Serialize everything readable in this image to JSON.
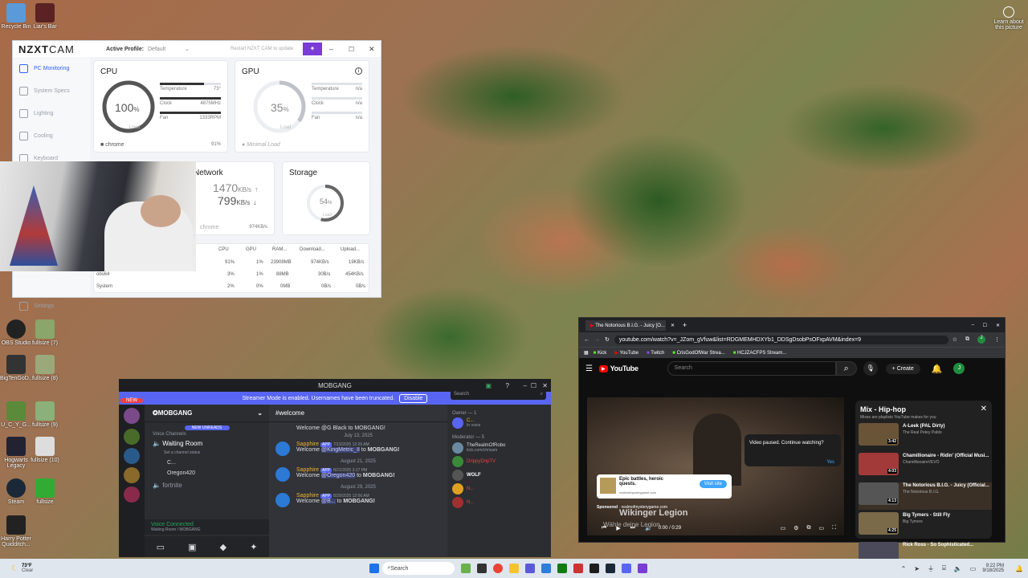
{
  "desktop": {
    "icons": [
      {
        "label": "Recycle Bin",
        "color": "#4a90c8"
      },
      {
        "label": "Liar's Bar",
        "color": "#3a2a2a"
      },
      {
        "label": "OBS Studio",
        "color": "#222"
      },
      {
        "label": "fullsize (7)",
        "color": "#8a7"
      },
      {
        "label": "BigTenGoD...",
        "color": "#333"
      },
      {
        "label": "fullsize (8)",
        "color": "#9a8"
      },
      {
        "label": "U_C_Y_G...",
        "color": "#6a4"
      },
      {
        "label": "fullsize (9)",
        "color": "#8b7"
      },
      {
        "label": "Hogwarts Legacy",
        "color": "#233"
      },
      {
        "label": "fullsize (10)",
        "color": "#ddd"
      },
      {
        "label": "Steam",
        "color": "#1b2838"
      },
      {
        "label": "fullsize",
        "color": "#3c3"
      },
      {
        "label": "Harry Potter Quidditch...",
        "color": "#222"
      }
    ],
    "learn": "Learn about this picture"
  },
  "nzxt": {
    "logo_bold": "NZXT",
    "logo_light": "CAM",
    "profile_label": "Active Profile:",
    "profile_value": "Default",
    "restart": "Restart NZXT CAM to update",
    "nav": [
      "PC Monitoring",
      "System Specs",
      "Lighting",
      "Cooling",
      "Keyboard"
    ],
    "settings": "Settings",
    "cpu": {
      "title": "CPU",
      "load": "100",
      "load_frac": 1.0,
      "load_label": "Load",
      "temp_label": "Temperature",
      "temp": "73°",
      "clock_label": "Clock",
      "clock": "4875MHz",
      "fan_label": "Fan",
      "fan": "1333RPM",
      "proc": "chrome",
      "proc_val": "91%"
    },
    "gpu": {
      "title": "GPU",
      "load": "35",
      "load_frac": 0.35,
      "load_label": "Load",
      "temp_label": "Temperature",
      "temp": "n/a",
      "clock_label": "Clock",
      "clock": "n/a",
      "fan_label": "Fan",
      "fan": "n/a",
      "proc": "Minimal Load"
    },
    "network": {
      "title": "Network",
      "down": "1470",
      "up": "799",
      "unit": "KB/s",
      "proc": "chrome",
      "proc_val": "974KB/s"
    },
    "storage": {
      "title": "Storage",
      "load": "54",
      "load_frac": 0.54,
      "load_label": "Load"
    },
    "table": {
      "headers": [
        "CPU",
        "GPU",
        "RAM...",
        "Download...",
        "Upload..."
      ],
      "rows": [
        {
          "name": "",
          "cpu": "91%",
          "gpu": "1%",
          "ram": "23908MB",
          "down": "974KB/s",
          "up": "19KB/s"
        },
        {
          "name": "obs64",
          "cpu": "3%",
          "gpu": "1%",
          "ram": "88MB",
          "down": "30B/s",
          "up": "454KB/s"
        },
        {
          "name": "System",
          "cpu": "2%",
          "gpu": "0%",
          "ram": "0MB",
          "down": "0B/s",
          "up": "0B/s"
        }
      ]
    }
  },
  "discord": {
    "title": "MOBGANG",
    "banner": "Streamer Mode is enabled. Usernames have been truncated.",
    "disable": "Disable",
    "server": "MOBGANG",
    "new_unreads": "NEW UNREADS",
    "voice_channels": "Voice Channels",
    "waiting_room": "Waiting Room",
    "channel_status": "Set a channel status",
    "voice_users": [
      "C...",
      "Oregon420"
    ],
    "fortnite": "fortnite",
    "voice_connected": "Voice Connected",
    "voice_path": "Waiting Room / MOBGANG",
    "channel": "welcome",
    "search": "Search",
    "messages": [
      {
        "top": "Welcome @G Black to MOBGANG!",
        "date": "July 13, 2025"
      },
      {
        "name": "Sapphire",
        "tag": "APP",
        "time": "7/13/2025 12:26 AM",
        "text_a": "Welcome ",
        "mention": "@KingMetric_II",
        "text_b": " to ",
        "bold": "MOBGANG!",
        "date_after": "August 21, 2025"
      },
      {
        "name": "Sapphire",
        "tag": "APP",
        "time": "8/21/2025 3:17 PM",
        "text_a": "Welcome ",
        "mention": "@Oregon420",
        "text_b": " to ",
        "bold": "MOBGANG!",
        "date_after": "August 29, 2025"
      },
      {
        "name": "Sapphire",
        "tag": "APP",
        "time": "8/29/2025 12:06 AM",
        "text_a": "Welcome ",
        "mention": "@B...",
        "text_b": " to ",
        "bold": "MOBGANG!"
      }
    ],
    "owner": "Owner — 1",
    "owner_user": "C...",
    "owner_status": "In voice",
    "moderator": "Moderator — 5",
    "mods": [
      {
        "name": "TheRealmOfRobo",
        "sub": "kick.com/chrisam",
        "color": "#dbdee1"
      },
      {
        "name": "DrippyDripTV",
        "sub": "",
        "color": "#f23f43"
      },
      {
        "name": "WOLF",
        "sub": "",
        "color": "#fff"
      },
      {
        "name": "N...",
        "sub": "",
        "color": "#f23f43"
      },
      {
        "name": "N...",
        "sub": "",
        "color": "#f23f43"
      }
    ],
    "badge_new": "NEW"
  },
  "youtube": {
    "tab": "The Notorious B.I.G. - Juicy [O...",
    "url": "youtube.com/watch?v=_JZom_gVfuw&list=RDGMEMHDXYb1_DDSgDsobPsOFxpAVM&index=9",
    "bookmarks": [
      "Kick",
      "YouTube",
      "Twitch",
      "CrisGodOfWar Strea...",
      "HCJZACFPS Stream..."
    ],
    "logo": "YouTube",
    "search": "Search",
    "create": "Create",
    "avatar": "J",
    "paused": "Video paused. Continue watching?",
    "yes": "Yes",
    "ad_title": "Epic battles, heroic quests.",
    "ad_url": "realmofmysterygame.com",
    "visit": "Visit site",
    "sponsored": "Sponsored",
    "ad_domain": "realmofmysterygame.com",
    "overlay_title": "Wikinger Legion",
    "overlay_sub": "Wähle deine Legion",
    "time": "0:00 / 0:29",
    "mix_title": "Mix - Hip-hop",
    "mix_sub": "Mixes are playlists YouTube makes for you",
    "mix": [
      {
        "title": "A-Leek (PAL Dirty)",
        "artist": "The Real Petey Pablo",
        "dur": "3:42"
      },
      {
        "title": "Chamillionaire - Ridin' (Official Musi...",
        "artist": "ChamillionaireVEVO",
        "dur": "4:03"
      },
      {
        "title": "The Notorious B.I.G. - Juicy (Official...",
        "artist": "The Notorious B.I.G.",
        "dur": "4:13"
      },
      {
        "title": "Big Tymers - Still Fly",
        "artist": "Big Tymers",
        "dur": "4:25"
      },
      {
        "title": "Rick Ross - So Sophisticated...",
        "artist": "",
        "dur": ""
      }
    ]
  },
  "taskbar": {
    "temp": "73°F",
    "weather": "Clear",
    "search": "Search",
    "time": "9:22 PM",
    "date": "9/18/2025"
  }
}
